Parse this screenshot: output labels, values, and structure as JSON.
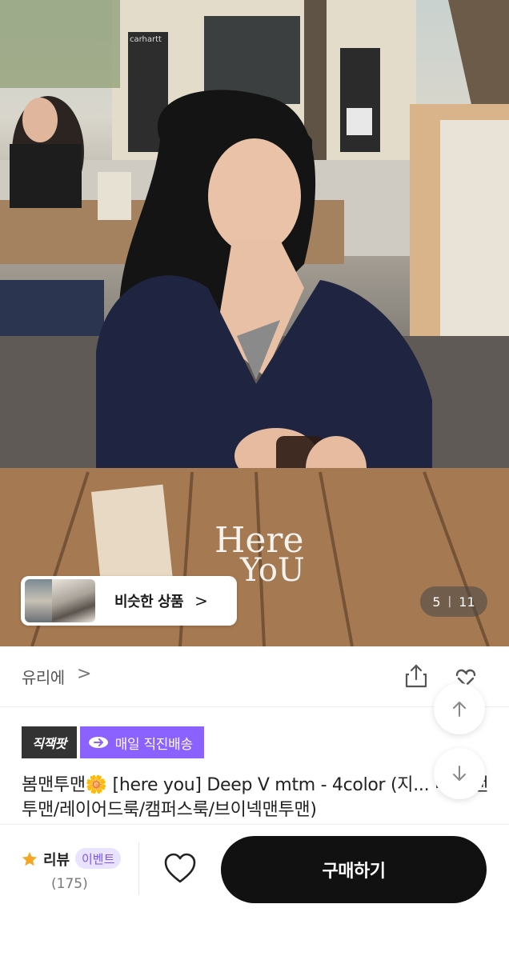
{
  "hero": {
    "watermark_line1": "Here",
    "watermark_line2": "YoU",
    "storefront_sign": "carhartt",
    "similar_label": "비슷한 상품",
    "similar_chevron": ">",
    "counter_current": "5",
    "counter_total": "11"
  },
  "store": {
    "name": "유리에",
    "chevron": ">"
  },
  "badges": {
    "direct": "직잭팟",
    "shipping": "매일 직진배송"
  },
  "product": {
    "title": "봄맨투맨🌼 [here you] Deep V mtm - 4color (지... 리/봄맨투맨/레이어드룩/캠퍼스룩/브이넥맨투맨)"
  },
  "bottom": {
    "review_label": "리뷰",
    "event_label": "이벤트",
    "review_count": "(175)",
    "buy_label": "구매하기"
  },
  "icons": {
    "share": "share-icon",
    "link": "link-icon",
    "up": "arrow-up-icon",
    "down": "arrow-down-icon",
    "star": "star-icon",
    "heart": "heart-icon",
    "truck": "truck-icon"
  },
  "colors": {
    "badge_purple": "#8b62ff",
    "badge_dark": "#333333",
    "event_text": "#7b55f5",
    "star": "#f5a623",
    "buy_button": "#111111"
  }
}
